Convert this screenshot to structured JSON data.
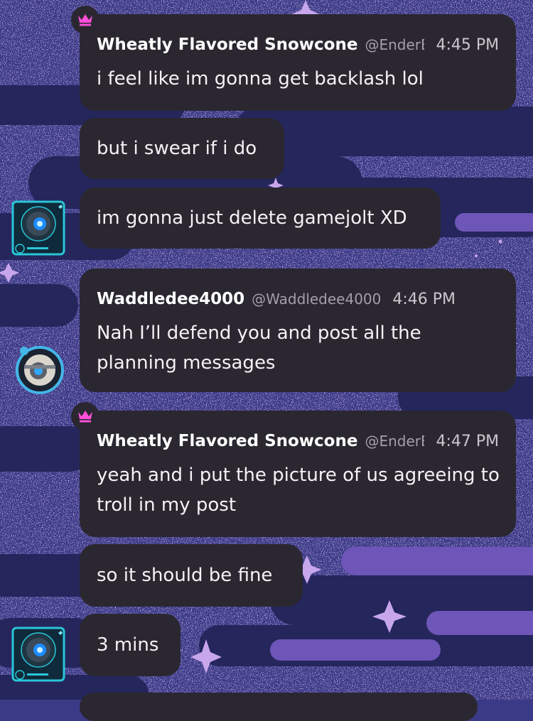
{
  "colors": {
    "bubble": "#2a2730",
    "background": "#3b3a86",
    "crown": "#ff4fd8",
    "avatar_frame": "#29c6d9"
  },
  "messages": [
    {
      "display_name": "Wheatly Flavored Snowcone",
      "handle": "@EnderE",
      "time": "4:45 PM",
      "lines": [
        "i feel like im gonna get backlash lol",
        "but i swear if i do",
        "im gonna just delete gamejolt XD"
      ]
    },
    {
      "display_name": "Waddledee4000",
      "handle": "@Waddledee4000",
      "time": "4:46 PM",
      "text": "Nah I’ll defend you and post all the planning messages"
    },
    {
      "display_name": "Wheatly Flavored Snowcone",
      "handle": "@EnderE",
      "time": "4:47 PM",
      "text": "yeah and i put the picture of us agreeing to troll in my post",
      "lines": [
        "so it should be fine",
        "3 mins"
      ]
    }
  ],
  "icons": {
    "crown": "crown-icon",
    "avatar_sphere": "sphere-robot-avatar",
    "avatar_robot": "robot-avatar"
  }
}
